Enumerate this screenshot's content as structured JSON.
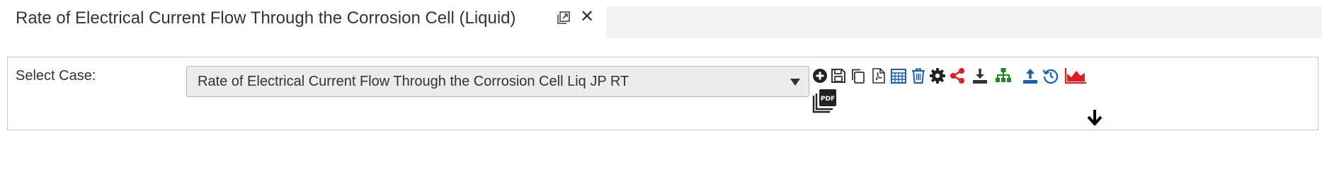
{
  "tab": {
    "title": "Rate of Electrical Current Flow Through the Corrosion Cell (Liquid)",
    "close_glyph": "✕",
    "popout_icon": "popout-icon",
    "close_icon": "close-icon"
  },
  "case_selector": {
    "label": "Select Case:",
    "selected_value": "Rate of Electrical Current Flow Through the Corrosion Cell Liq JP RT"
  },
  "toolbar": {
    "tools": [
      {
        "name": "add-case-button",
        "icon": "plus-circle-icon",
        "color": "#222222"
      },
      {
        "name": "save-button",
        "icon": "save-icon",
        "color": "#333333"
      },
      {
        "name": "copy-button",
        "icon": "copy-icon",
        "color": "#333333"
      },
      {
        "name": "export-pdf-button",
        "icon": "pdf-file-icon",
        "color": "#333333"
      },
      {
        "name": "calculator-button",
        "icon": "table-grid-icon",
        "color": "#1a5fb4"
      },
      {
        "name": "delete-button",
        "icon": "trash-icon",
        "color": "#1a5fb4"
      },
      {
        "name": "settings-button",
        "icon": "gear-icon",
        "color": "#222222"
      },
      {
        "name": "share-button",
        "icon": "share-icon",
        "color": "#e01b24"
      },
      {
        "name": "download-button",
        "icon": "download-icon",
        "color": "#333333"
      },
      {
        "name": "hierarchy-button",
        "icon": "sitemap-icon",
        "color": "#1f8a1f"
      },
      {
        "name": "upload-button",
        "icon": "upload-icon",
        "color": "#1a5fb4"
      },
      {
        "name": "history-button",
        "icon": "history-icon",
        "color": "#1a5fb4"
      },
      {
        "name": "chart-button",
        "icon": "area-chart-icon",
        "color": "#e01b24"
      }
    ],
    "pdf_stack_icon": "pdf-stack-icon",
    "expand_icon": "arrow-down-icon",
    "pdf_badge_text": "PDF"
  }
}
